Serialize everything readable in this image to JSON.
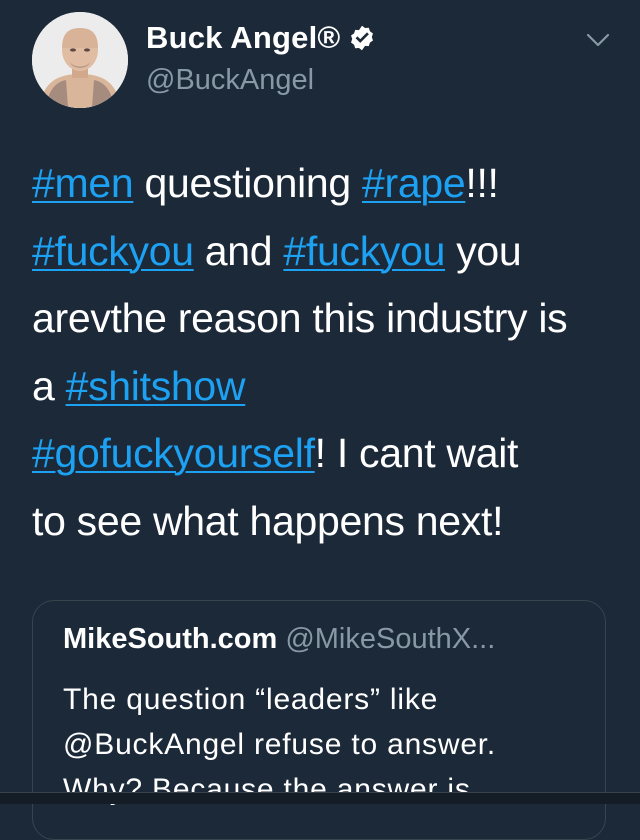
{
  "tweet": {
    "author": {
      "display_name": "Buck Angel®",
      "handle": "@BuckAngel",
      "verified_icon": "verified-badge-icon",
      "avatar": "avatar-photo"
    },
    "menu_icon": "chevron-down-icon",
    "text_lines": [
      [
        {
          "t": "#men",
          "tag": true
        },
        {
          "t": " questioning ",
          "tag": false
        },
        {
          "t": "#rape",
          "tag": true
        },
        {
          "t": "!!!",
          "tag": false
        }
      ],
      [
        {
          "t": "#fuckyou",
          "tag": true
        },
        {
          "t": " and ",
          "tag": false
        },
        {
          "t": "#fuckyou",
          "tag": true
        },
        {
          "t": " you",
          "tag": false
        }
      ],
      [
        {
          "t": "arevthe reason this industry is",
          "tag": false
        }
      ],
      [
        {
          "t": "a ",
          "tag": false
        },
        {
          "t": "#shitshow",
          "tag": true
        }
      ],
      [
        {
          "t": "#gofuckyourself",
          "tag": true
        },
        {
          "t": "! I cant wait",
          "tag": false
        }
      ],
      [
        {
          "t": "to see what happens next!",
          "tag": false
        }
      ]
    ],
    "quoted_tweet": {
      "display_name": "MikeSouth.com",
      "handle": "@MikeSouthX...",
      "text_lines": [
        "The question “leaders” like",
        "@BuckAngel refuse to answer.",
        "Why? Because the answer is"
      ]
    }
  },
  "colors": {
    "background": "#1c2938",
    "hashtag": "#1da1f2",
    "secondary_text": "#8899a6",
    "border": "#38444d"
  }
}
